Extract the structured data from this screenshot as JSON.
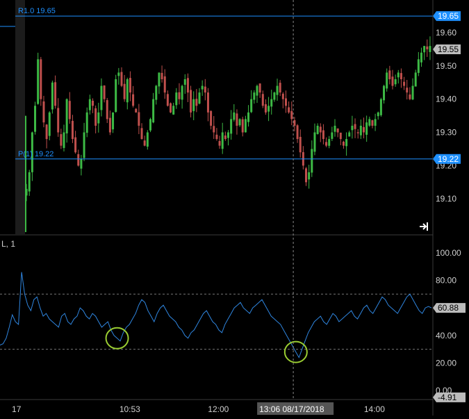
{
  "chart_data": [
    {
      "type": "candlestick",
      "ylim": [
        19.0,
        19.69
      ],
      "ticks": [
        19.1,
        19.2,
        19.3,
        19.4,
        19.5,
        19.6
      ],
      "tick_labels": [
        "19.10",
        "19.20",
        "19.30",
        "19.40",
        "19.50",
        "19.60"
      ],
      "levels": [
        {
          "name": "R1",
          "label": "R1.0  19.65",
          "value": 19.65,
          "badge": "19.65"
        },
        {
          "name": "P",
          "label": "P(1)  19.22",
          "value": 19.22,
          "badge": "19.22"
        }
      ],
      "last_price": 19.55,
      "last_price_label": "19.55",
      "price_series": [
        19.13,
        19.18,
        19.3,
        19.38,
        19.52,
        19.4,
        19.33,
        19.28,
        19.36,
        19.45,
        19.38,
        19.3,
        19.26,
        19.3,
        19.4,
        19.34,
        19.28,
        19.24,
        19.2,
        19.22,
        19.3,
        19.36,
        19.4,
        19.38,
        19.32,
        19.36,
        19.44,
        19.4,
        19.34,
        19.3,
        19.36,
        19.46,
        19.48,
        19.44,
        19.4,
        19.46,
        19.42,
        19.38,
        19.36,
        19.32,
        19.28,
        19.26,
        19.3,
        19.34,
        19.4,
        19.44,
        19.48,
        19.46,
        19.42,
        19.38,
        19.36,
        19.38,
        19.42,
        19.4,
        19.44,
        19.46,
        19.42,
        19.36,
        19.4,
        19.38,
        19.42,
        19.44,
        19.42,
        19.36,
        19.32,
        19.3,
        19.28,
        19.26,
        19.3,
        19.28,
        19.3,
        19.34,
        19.36,
        19.32,
        19.34,
        19.3,
        19.34,
        19.36,
        19.4,
        19.42,
        19.44,
        19.42,
        19.38,
        19.36,
        19.38,
        19.4,
        19.42,
        19.44,
        19.42,
        19.4,
        19.38,
        19.36,
        19.34,
        19.32,
        19.28,
        19.24,
        19.2,
        19.15,
        19.18,
        19.25,
        19.3,
        19.32,
        19.3,
        19.28,
        19.26,
        19.28,
        19.3,
        19.32,
        19.3,
        19.28,
        19.26,
        19.28,
        19.3,
        19.32,
        19.31,
        19.3,
        19.32,
        19.3,
        19.33,
        19.34,
        19.32,
        19.34,
        19.36,
        19.4,
        19.44,
        19.48,
        19.46,
        19.44,
        19.46,
        19.48,
        19.46,
        19.44,
        19.42,
        19.4,
        19.44,
        19.48,
        19.52,
        19.54,
        19.56,
        19.55,
        19.56
      ],
      "rsi": {
        "title": "L, 1",
        "ylim": [
          -5,
          110
        ],
        "ticks": [
          0,
          20,
          40,
          60,
          80,
          100
        ],
        "tick_labels": [
          "0.00",
          "20.00",
          "40.00",
          "60.00",
          "80.00",
          "100.00"
        ],
        "overbought": 70,
        "oversold": 30,
        "last_value_label": "60.88",
        "min_value_label": "-4.91",
        "values": [
          33,
          34,
          38,
          46,
          55,
          50,
          48,
          86,
          70,
          62,
          58,
          66,
          68,
          60,
          54,
          56,
          52,
          50,
          48,
          46,
          54,
          56,
          50,
          48,
          52,
          54,
          60,
          58,
          54,
          52,
          56,
          54,
          50,
          46,
          48,
          50,
          44,
          40,
          38,
          36,
          42,
          46,
          48,
          52,
          56,
          62,
          66,
          64,
          58,
          54,
          50,
          56,
          60,
          62,
          58,
          54,
          52,
          50,
          46,
          44,
          40,
          38,
          42,
          44,
          48,
          52,
          56,
          58,
          54,
          50,
          48,
          44,
          42,
          48,
          52,
          56,
          60,
          62,
          64,
          60,
          58,
          56,
          60,
          62,
          64,
          66,
          62,
          58,
          54,
          52,
          50,
          48,
          44,
          40,
          36,
          32,
          28,
          24,
          30,
          36,
          42,
          46,
          50,
          52,
          54,
          50,
          48,
          52,
          56,
          54,
          50,
          52,
          54,
          56,
          58,
          54,
          52,
          56,
          60,
          62,
          58,
          56,
          60,
          64,
          68,
          66,
          62,
          60,
          58,
          56,
          60,
          64,
          68,
          70,
          66,
          62,
          58,
          56,
          60,
          61,
          60
        ]
      },
      "x_ticks": [
        {
          "label": "17",
          "pos": 0.005
        },
        {
          "label": "10:53",
          "pos": 0.26
        },
        {
          "label": "12:00",
          "pos": 0.47
        },
        {
          "label": "14:00",
          "pos": 0.84
        }
      ],
      "cursor": {
        "time_label": "13:06 08/17/2018",
        "pos": 0.66
      },
      "markers": [
        {
          "name": "rsi-low-circle-1",
          "index": 38
        },
        {
          "name": "rsi-low-circle-2",
          "index": 96
        }
      ],
      "colors": {
        "background": "#000000",
        "up": "#3dba45",
        "down": "#c0504d",
        "level_line": "#1e90ff",
        "badge": "#1e90ff",
        "rsi_line": "#2f86e0",
        "marker": "#9acd32",
        "grid_text": "#d0d0d0"
      }
    }
  ]
}
